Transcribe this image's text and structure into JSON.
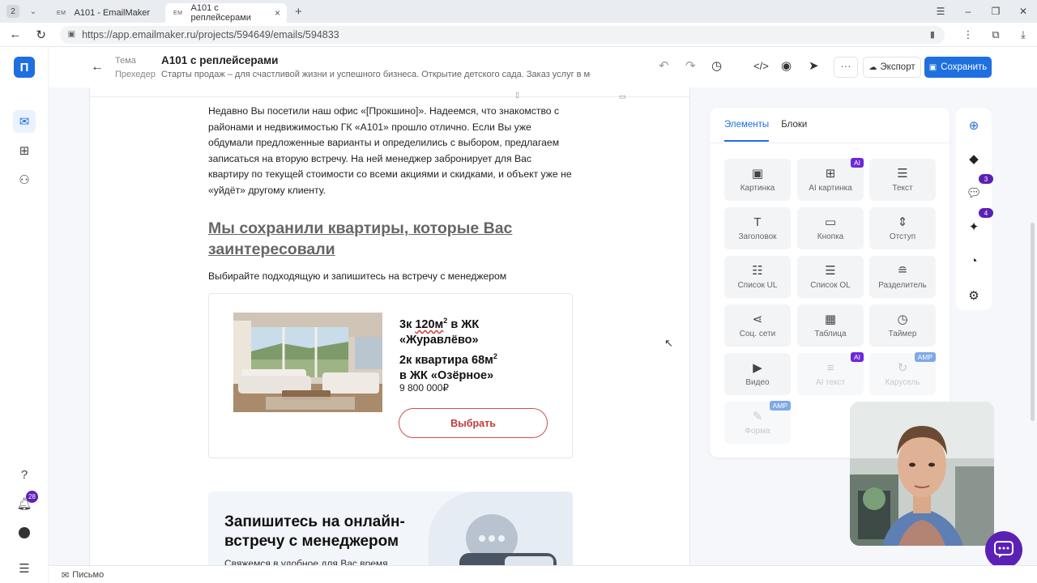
{
  "browser": {
    "tab_count": "2",
    "tabs": [
      {
        "favicon": "EM",
        "title": "A101 - EmailMaker"
      },
      {
        "favicon": "EM",
        "title": "A101 с реплейсерами"
      }
    ],
    "url": "https://app.emailmaker.ru/projects/594649/emails/594833"
  },
  "sidebar": {
    "logo": "П",
    "notification_count": "28"
  },
  "header": {
    "theme_label": "Тема",
    "preheader_label": "Прехедер",
    "title": "A101 с реплейсерами",
    "preheader": "Старты продаж – для счастливой жизни и успешного бизнеса. Открытие детского сада. Заказ услуг в моб...",
    "more_label": "···",
    "export_label": "Экспорт",
    "save_label": "Сохранить"
  },
  "email": {
    "paragraph": "Недавно Вы посетили наш офис «[Прокшино]». Надеемся, что знакомство с районами и недвижимостью ГК «А101» прошло отлично. Если Вы уже обдумали предложенные варианты и определились с выбором, предлагаем записаться на вторую встречу. На ней менеджер забронирует для Вас квартиру по текущей стоимости со всеми акциями и скидками, и объект уже не «уйдёт» другому клиенту.",
    "heading": "Мы сохранили квартиры, которые Вас заинтересовали",
    "subheading": "Выбирайте подходящую и запишитесь на встречу с менеджером",
    "card": {
      "line1_a": "3к ",
      "line1_b": "120м",
      "line1_sup": "2",
      "line1_c": " в ЖК",
      "line2": "«Журавлёво»",
      "line3_a": "2к квартира 68м",
      "line3_sup": "2",
      "line4": "в ЖК «Озёрное»",
      "price": "9 800 000₽",
      "button": "Выбрать"
    },
    "promo": {
      "title": "Запишитесь на онлайн-встречу с менеджером",
      "subtitle": "Свяжемся в удобное для Вас время"
    }
  },
  "panel": {
    "tabs": [
      "Элементы",
      "Блоки"
    ],
    "tiles": [
      {
        "label": "Картинка",
        "icon": "image-icon",
        "glyph": "▣"
      },
      {
        "label": "AI картинка",
        "icon": "ai-image-icon",
        "glyph": "⊞",
        "tag": "AI"
      },
      {
        "label": "Текст",
        "icon": "text-icon",
        "glyph": "☰"
      },
      {
        "label": "Заголовок",
        "icon": "heading-icon",
        "glyph": "T"
      },
      {
        "label": "Кнопка",
        "icon": "button-icon",
        "glyph": "▭"
      },
      {
        "label": "Отступ",
        "icon": "spacer-icon",
        "glyph": "⇕"
      },
      {
        "label": "Список UL",
        "icon": "list-ul-icon",
        "glyph": "☷"
      },
      {
        "label": "Список OL",
        "icon": "list-ol-icon",
        "glyph": "☰"
      },
      {
        "label": "Разделитель",
        "icon": "divider-icon",
        "glyph": "≘"
      },
      {
        "label": "Соц. сети",
        "icon": "share-icon",
        "glyph": "⋖"
      },
      {
        "label": "Таблица",
        "icon": "table-icon",
        "glyph": "▦"
      },
      {
        "label": "Таймер",
        "icon": "timer-icon",
        "glyph": "◷"
      },
      {
        "label": "Видео",
        "icon": "video-icon",
        "glyph": "▶"
      },
      {
        "label": "AI текст",
        "icon": "ai-text-icon",
        "glyph": "≡",
        "tag": "AI",
        "disabled": true
      },
      {
        "label": "Карусель",
        "icon": "carousel-icon",
        "glyph": "↻",
        "tag": "AMP",
        "disabled": true
      },
      {
        "label": "Форма",
        "icon": "form-icon",
        "glyph": "✎",
        "tag": "AMP",
        "disabled": true
      }
    ]
  },
  "rail": {
    "badge_comments": "3",
    "badge_magic": "4"
  },
  "status": {
    "tab_label": "Письмо"
  },
  "colors": {
    "accent": "#1e6fe0",
    "badge": "#5b21b6",
    "cta_red": "#d44b4b"
  }
}
